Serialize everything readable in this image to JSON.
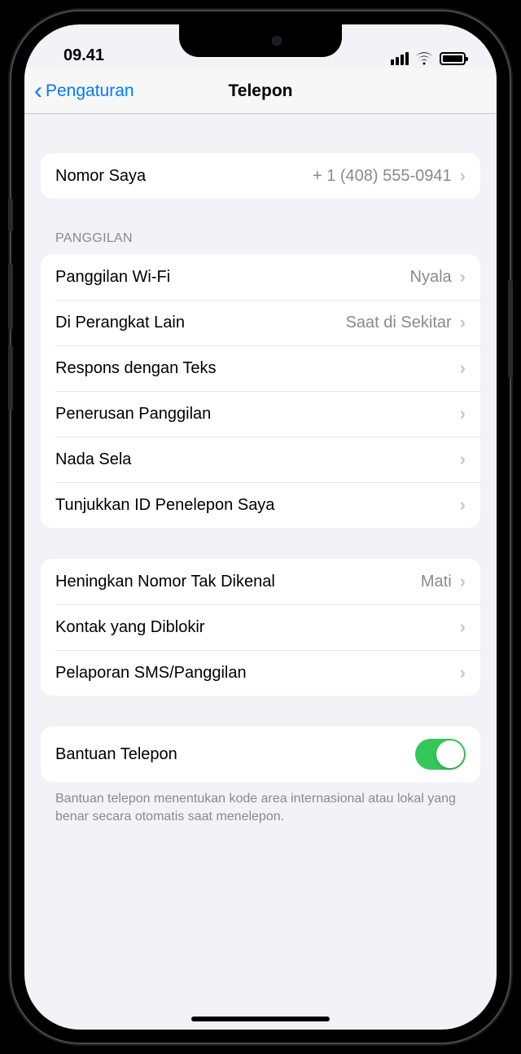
{
  "status": {
    "time": "09.41"
  },
  "nav": {
    "back_label": "Pengaturan",
    "title": "Telepon"
  },
  "my_number": {
    "label": "Nomor Saya",
    "value": "+ 1 (408) 555-0941"
  },
  "calls": {
    "header": "PANGGILAN",
    "items": [
      {
        "label": "Panggilan Wi-Fi",
        "value": "Nyala"
      },
      {
        "label": "Di Perangkat Lain",
        "value": "Saat di Sekitar"
      },
      {
        "label": "Respons dengan Teks",
        "value": ""
      },
      {
        "label": "Penerusan Panggilan",
        "value": ""
      },
      {
        "label": "Nada Sela",
        "value": ""
      },
      {
        "label": "Tunjukkan ID Penelepon Saya",
        "value": ""
      }
    ]
  },
  "silence": {
    "items": [
      {
        "label": "Heningkan Nomor Tak Dikenal",
        "value": "Mati"
      },
      {
        "label": "Kontak yang Diblokir",
        "value": ""
      },
      {
        "label": "Pelaporan SMS/Panggilan",
        "value": ""
      }
    ]
  },
  "assist": {
    "label": "Bantuan Telepon",
    "toggle": true,
    "footer": "Bantuan telepon menentukan kode area internasional atau lokal yang benar secara otomatis saat menelepon."
  }
}
